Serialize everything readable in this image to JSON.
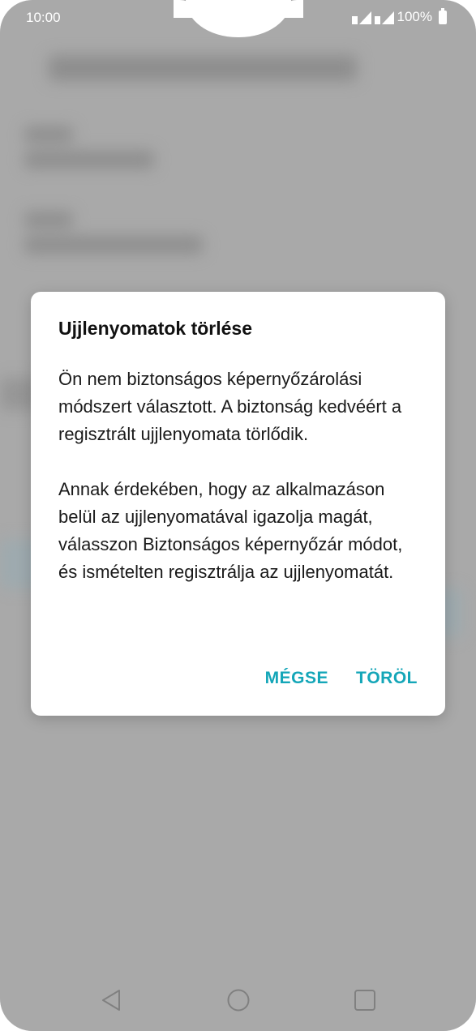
{
  "status_bar": {
    "time": "10:00",
    "battery": "100%"
  },
  "dialog": {
    "title": "Ujjlenyomatok törlése",
    "paragraph1": "Ön nem biztonságos képernyőzárolási módszert választott. A biztonság kedvéért a regisztrált ujjlenyomata törlődik.",
    "paragraph2": "Annak érdekében, hogy az alkalmazáson belül az ujjlenyomatával igazolja magát, válasszon Biztonságos képernyőzár módot, és ismételten regisztrálja az ujjlenyomatát.",
    "cancel_label": "MÉGSE",
    "delete_label": "TÖRÖL"
  },
  "colors": {
    "accent": "#14a6b8",
    "background_dim": "#b3b3b3"
  },
  "nav_bar": {
    "back_icon": "back-triangle-icon",
    "home_icon": "home-circle-icon",
    "recents_icon": "recents-square-icon"
  }
}
